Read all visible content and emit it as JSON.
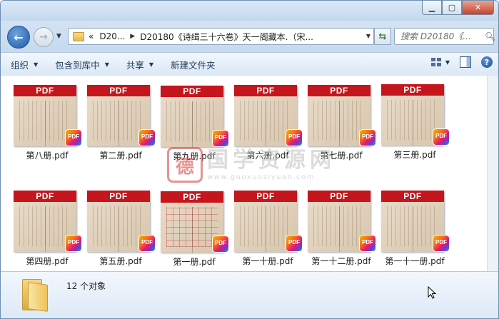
{
  "window": {
    "controls": {
      "minimize": "▁",
      "maximize": "▢",
      "close": "✕"
    }
  },
  "nav": {
    "back_icon": "back-arrow-icon",
    "forward_icon": "forward-arrow-icon",
    "address_prefix": "«",
    "breadcrumbs": [
      "D20...",
      "D20180《诗缉三十六卷》天一阁藏本.（宋..."
    ],
    "search_placeholder": "搜索 D20180《..."
  },
  "toolbar": {
    "organize": "组织",
    "include_in_library": "包含到库中",
    "share": "共享",
    "new_folder": "新建文件夹"
  },
  "files": [
    {
      "name": "第八册.pdf",
      "band": "PDF",
      "badge": "PDF",
      "style": "text"
    },
    {
      "name": "第二册.pdf",
      "band": "PDF",
      "badge": "PDF",
      "style": "text"
    },
    {
      "name": "第九册.pdf",
      "band": "PDF",
      "badge": "PDF",
      "style": "text"
    },
    {
      "name": "第六册.pdf",
      "band": "PDF",
      "badge": "PDF",
      "style": "text"
    },
    {
      "name": "第七册.pdf",
      "band": "PDF",
      "badge": "PDF",
      "style": "text"
    },
    {
      "name": "第三册.pdf",
      "band": "PDF",
      "badge": "PDF",
      "style": "text"
    },
    {
      "name": "第四册.pdf",
      "band": "PDF",
      "badge": "PDF",
      "style": "text"
    },
    {
      "name": "第五册.pdf",
      "band": "PDF",
      "badge": "PDF",
      "style": "text"
    },
    {
      "name": "第一册.pdf",
      "band": "PDF",
      "badge": "PDF",
      "style": "grid"
    },
    {
      "name": "第一十册.pdf",
      "band": "PDF",
      "badge": "PDF",
      "style": "text"
    },
    {
      "name": "第一十二册.pdf",
      "band": "PDF",
      "badge": "PDF",
      "style": "text"
    },
    {
      "name": "第一十一册.pdf",
      "band": "PDF",
      "badge": "PDF",
      "style": "text"
    }
  ],
  "watermark": {
    "logo_char": "德",
    "title": "国学资源网",
    "url": "www.guoxuoziyuan.com"
  },
  "status": {
    "count_text": "12 个对象"
  },
  "colors": {
    "pdf_band": "#c4161c",
    "window_frame": "#c9dcf0",
    "toolbar_text": "#1e395b"
  }
}
